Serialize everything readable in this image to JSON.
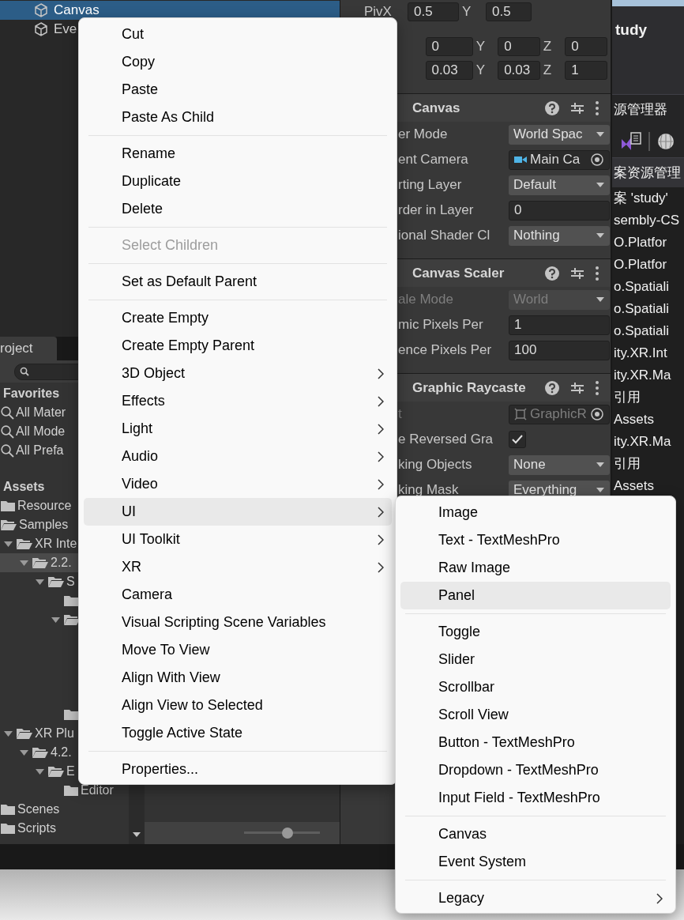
{
  "hierarchy": {
    "items": [
      {
        "label": "Canvas",
        "selected": true
      },
      {
        "label": "Eve",
        "selected": false
      }
    ]
  },
  "project": {
    "tab": "roject",
    "favorites_header": "Favorites",
    "favorites": [
      "All Mater",
      "All Mode",
      "All Prefa"
    ],
    "assets_header": "Assets",
    "tree": [
      {
        "label": "Resource",
        "selected": false
      },
      {
        "label": "Samples",
        "expanded": true,
        "selected": false,
        "children": [
          {
            "label": "XR Inte",
            "expanded": true,
            "selected": false,
            "children": [
              {
                "label": "2.2.",
                "expanded": true,
                "selected": true,
                "children": [
                  {
                    "label": "S",
                    "expanded": true,
                    "selected": false,
                    "children": [
                      {
                        "selected": false
                      },
                      {
                        "expanded": true,
                        "selected": false
                      },
                      {
                        "selected": false
                      }
                    ]
                  }
                ]
              }
            ]
          },
          {
            "label": "XR Plu",
            "expanded": true,
            "selected": false,
            "children": [
              {
                "label": "4.2.",
                "expanded": true,
                "selected": false,
                "children": [
                  {
                    "label": "E",
                    "expanded": true,
                    "selected": false,
                    "children": [
                      {
                        "label": "Editor",
                        "selected": false
                      }
                    ]
                  }
                ]
              }
            ]
          }
        ]
      },
      {
        "label": "Scenes",
        "selected": false
      },
      {
        "label": "Scripts",
        "selected": false
      }
    ],
    "zoom_slider": {
      "level": 0.58
    }
  },
  "inspector": {
    "vector_rows": [
      {
        "items": [
          {
            "label": "PivX",
            "value": "0.5"
          },
          {
            "label": "Y",
            "value": "0.5"
          }
        ]
      },
      {
        "items": [
          {
            "value": "0"
          },
          {
            "label": "Y",
            "value": "0"
          },
          {
            "label": "Z",
            "value": "0"
          }
        ]
      },
      {
        "items": [
          {
            "value": "0.03"
          },
          {
            "label": "Y",
            "value": "0.03"
          },
          {
            "label": "Z",
            "value": "1"
          }
        ]
      }
    ],
    "components": [
      {
        "title": "Canvas",
        "rows": [
          {
            "label": "er Mode",
            "kind": "dropdown",
            "value": "World Spac",
            "disabled": false
          },
          {
            "label": "ent Camera",
            "kind": "object",
            "value": "Main Ca",
            "disabled": false
          },
          {
            "label": "rting Layer",
            "kind": "dropdown",
            "value": "Default",
            "disabled": false
          },
          {
            "label": "rder in Layer",
            "kind": "text",
            "value": "0",
            "disabled": false
          },
          {
            "label": "ional Shader Cl",
            "kind": "dropdown",
            "value": "Nothing",
            "disabled": false
          }
        ]
      },
      {
        "title": "Canvas Scaler",
        "rows": [
          {
            "label": "ale Mode",
            "kind": "dropdown",
            "value": "World",
            "disabled": true
          },
          {
            "label": "mic Pixels Per",
            "kind": "text",
            "value": "1",
            "disabled": false
          },
          {
            "label": "ence Pixels Per",
            "kind": "text",
            "value": "100",
            "disabled": false
          }
        ]
      },
      {
        "title": "Graphic Raycaste",
        "rows": [
          {
            "label": "t",
            "kind": "object",
            "value": "GraphicR",
            "disabled": true
          },
          {
            "label": "e Reversed Gra",
            "kind": "checkbox",
            "checked": true,
            "disabled": false
          },
          {
            "label": "king Objects",
            "kind": "dropdown",
            "value": "None",
            "disabled": false
          },
          {
            "label": "king Mask",
            "kind": "dropdown",
            "value": "Everything",
            "disabled": false
          }
        ]
      }
    ]
  },
  "solution_explorer": {
    "title": "tudy",
    "tab": "源管理器",
    "header": "案资源管理",
    "items": [
      "案 'study'",
      "sembly-CS",
      "O.Platfor",
      "O.Platfor",
      "o.Spatiali",
      "o.Spatiali",
      "o.Spatiali",
      "ity.XR.Int",
      "ity.XR.Ma",
      "引用",
      "Assets",
      "ity.XR.Ma",
      "引用",
      "Assets"
    ]
  },
  "context_menu": {
    "groups": [
      [
        {
          "label": "Cut",
          "submenu": false,
          "disabled": false,
          "selected": false
        },
        {
          "label": "Copy",
          "submenu": false,
          "disabled": false,
          "selected": false
        },
        {
          "label": "Paste",
          "submenu": false,
          "disabled": false,
          "selected": false
        },
        {
          "label": "Paste As Child",
          "submenu": false,
          "disabled": false,
          "selected": false
        }
      ],
      [
        {
          "label": "Rename",
          "submenu": false,
          "disabled": false,
          "selected": false
        },
        {
          "label": "Duplicate",
          "submenu": false,
          "disabled": false,
          "selected": false
        },
        {
          "label": "Delete",
          "submenu": false,
          "disabled": false,
          "selected": false
        }
      ],
      [
        {
          "label": "Select Children",
          "submenu": false,
          "disabled": true,
          "selected": false
        }
      ],
      [
        {
          "label": "Set as Default Parent",
          "submenu": false,
          "disabled": false,
          "selected": false
        }
      ],
      [
        {
          "label": "Create Empty",
          "submenu": false,
          "disabled": false,
          "selected": false
        },
        {
          "label": "Create Empty Parent",
          "submenu": false,
          "disabled": false,
          "selected": false
        },
        {
          "label": "3D Object",
          "submenu": true,
          "disabled": false,
          "selected": false
        },
        {
          "label": "Effects",
          "submenu": true,
          "disabled": false,
          "selected": false
        },
        {
          "label": "Light",
          "submenu": true,
          "disabled": false,
          "selected": false
        },
        {
          "label": "Audio",
          "submenu": true,
          "disabled": false,
          "selected": false
        },
        {
          "label": "Video",
          "submenu": true,
          "disabled": false,
          "selected": false
        },
        {
          "label": "UI",
          "submenu": true,
          "disabled": false,
          "selected": true
        },
        {
          "label": "UI Toolkit",
          "submenu": true,
          "disabled": false,
          "selected": false
        },
        {
          "label": "XR",
          "submenu": true,
          "disabled": false,
          "selected": false
        },
        {
          "label": "Camera",
          "submenu": false,
          "disabled": false,
          "selected": false
        },
        {
          "label": "Visual Scripting Scene Variables",
          "submenu": false,
          "disabled": false,
          "selected": false
        },
        {
          "label": "Move To View",
          "submenu": false,
          "disabled": false,
          "selected": false
        },
        {
          "label": "Align With View",
          "submenu": false,
          "disabled": false,
          "selected": false
        },
        {
          "label": "Align View to Selected",
          "submenu": false,
          "disabled": false,
          "selected": false
        },
        {
          "label": "Toggle Active State",
          "submenu": false,
          "disabled": false,
          "selected": false
        }
      ],
      [
        {
          "label": "Properties...",
          "submenu": false,
          "disabled": false,
          "selected": false
        }
      ]
    ]
  },
  "submenu": {
    "groups": [
      [
        {
          "label": "Image",
          "submenu": false,
          "disabled": false,
          "selected": false
        },
        {
          "label": "Text - TextMeshPro",
          "submenu": false,
          "disabled": false,
          "selected": false
        },
        {
          "label": "Raw Image",
          "submenu": false,
          "disabled": false,
          "selected": false
        },
        {
          "label": "Panel",
          "submenu": false,
          "disabled": false,
          "selected": true
        }
      ],
      [
        {
          "label": "Toggle",
          "submenu": false,
          "disabled": false,
          "selected": false
        },
        {
          "label": "Slider",
          "submenu": false,
          "disabled": false,
          "selected": false
        },
        {
          "label": "Scrollbar",
          "submenu": false,
          "disabled": false,
          "selected": false
        },
        {
          "label": "Scroll View",
          "submenu": false,
          "disabled": false,
          "selected": false
        },
        {
          "label": "Button - TextMeshPro",
          "submenu": false,
          "disabled": false,
          "selected": false
        },
        {
          "label": "Dropdown - TextMeshPro",
          "submenu": false,
          "disabled": false,
          "selected": false
        },
        {
          "label": "Input Field - TextMeshPro",
          "submenu": false,
          "disabled": false,
          "selected": false
        }
      ],
      [
        {
          "label": "Canvas",
          "submenu": false,
          "disabled": false,
          "selected": false
        },
        {
          "label": "Event System",
          "submenu": false,
          "disabled": false,
          "selected": false
        }
      ],
      [
        {
          "label": "Legacy",
          "submenu": true,
          "disabled": false,
          "selected": false
        }
      ]
    ]
  }
}
